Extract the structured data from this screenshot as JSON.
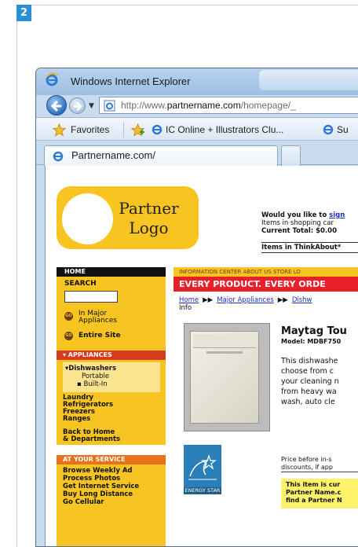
{
  "step_number": "2",
  "browser": {
    "window_title": "Windows Internet Explorer",
    "url_prefix": "http://www.",
    "url_domain": "partnername.com",
    "url_suffix": "/homepage/_",
    "favorites_label": "Favorites",
    "favorites_links": [
      "IC Online + Illustrators Clu...",
      "Su"
    ],
    "tab_title": "Partnername.com/"
  },
  "page": {
    "logo_line1": "Partner",
    "logo_line2": "Logo",
    "cart_question": "Would you like to ",
    "cart_link": "sign",
    "cart_items": "Items in shopping car",
    "cart_total": "Current Total: $0.00",
    "think_about": "Items in ThinkAbout*",
    "nav": {
      "home": "HOME",
      "search": "SEARCH",
      "radio_major": [
        "In Major",
        "Appliances"
      ],
      "radio_site": "Entire Site",
      "appliances_head": "▾ APPLIANCES",
      "dishwashers": "▾Dishwashers",
      "portable": "Portable",
      "builtin": "▪ Built-In",
      "categories": [
        "Laundry",
        "Refrigerators",
        "Freezers",
        "Ranges"
      ],
      "back_home": [
        "Back to Home",
        "& Departments"
      ],
      "service_head": "AT YOUR SERVICE",
      "service_items": [
        "Browse Weekly Ad",
        "Process Photos",
        "Get Internet Service",
        "Buy Long Distance",
        "Go Cellular"
      ]
    },
    "top_menu": "INFORMATION CENTER   ABOUT US   STORE LO",
    "promo": "EVERY PRODUCT.  EVERY ORDE",
    "breadcrumbs": [
      "Home",
      "Major Appliances",
      "Dishw"
    ],
    "breadcrumb_sep": "▶▶",
    "crumb_info": "Info",
    "product_title": "Maytag Tou",
    "product_model": "Model: MDBF750",
    "product_desc": [
      "This dishwashe",
      "choose from c",
      "your cleaning n",
      "from heavy wa",
      "wash, auto cle"
    ],
    "energy_label": "ENERGY STAR",
    "price_note": [
      "Price before in-s",
      "discounts, if app"
    ],
    "availability": [
      "This item is cur",
      "Partner Name.c",
      "find a Partner N"
    ]
  },
  "colors": {
    "yellow": "#f8c421",
    "red": "#e8202a",
    "badge_blue": "#2b8fd8"
  }
}
